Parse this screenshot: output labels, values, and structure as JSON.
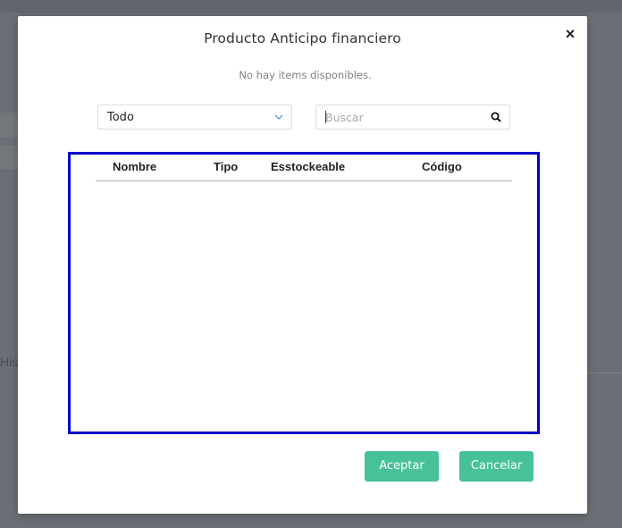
{
  "background": {
    "partial_label": "Hist"
  },
  "modal": {
    "title": "Producto Anticipo financiero",
    "close_symbol": "×",
    "empty_message": "No hay items disponibles.",
    "filter": {
      "selected": "Todo",
      "icon": "chevron-down-icon"
    },
    "search": {
      "placeholder": "Buscar",
      "value": "",
      "icon": "search-icon"
    },
    "table": {
      "columns": [
        "Nombre",
        "Tipo",
        "Esstockeable",
        "Código"
      ],
      "rows": []
    },
    "buttons": {
      "accept": "Aceptar",
      "cancel": "Cancelar"
    },
    "colors": {
      "primary": "#47c296",
      "highlight_border": "#0000cc"
    }
  }
}
